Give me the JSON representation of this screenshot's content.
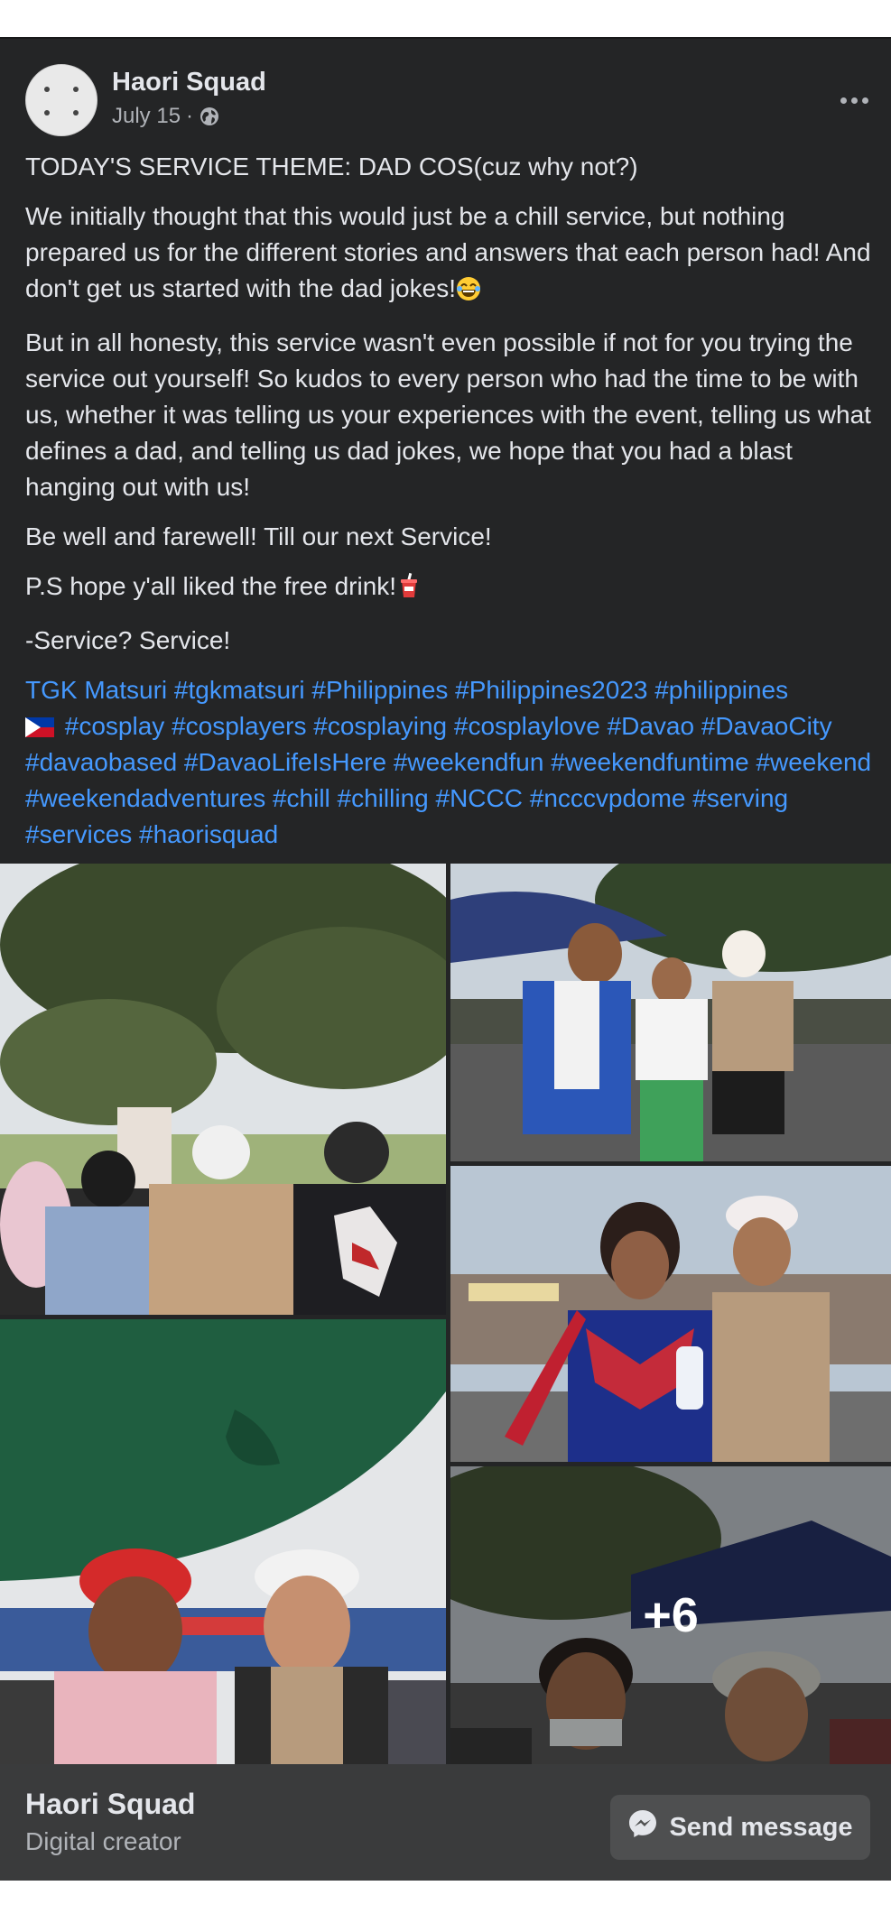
{
  "post": {
    "author": "Haori Squad",
    "date": "July 15",
    "separator": "·",
    "paragraphs": [
      "TODAY'S SERVICE THEME: DAD COS(cuz why not?)",
      "We initially thought that this would just be a chill service, but nothing prepared us for the different stories and answers that each person had! And don't get us started with the dad jokes!",
      "But in all honesty, this service wasn't even possible if not for you trying the service out yourself! So kudos to every person who had the time to be with us, whether it was telling us your experiences with the event, telling us what defines a dad, and telling us dad jokes, we hope that you had a blast hanging out with us!",
      "Be well and farewell! Till our next Service!",
      "P.S hope y'all liked the free drink!",
      "-Service? Service!"
    ],
    "hashtags_line1": "TGK Matsuri #tgkmatsuri #Philippines #Philippines2023 #philippines",
    "hashtags_rest": "#cosplay #cosplayers #cosplaying #cosplaylove #Davao #DavaoCity #davaobased #DavaoLifeIsHere #weekendfun #weekendfuntime #weekend #weekendadventures #chill #chilling #NCCC #ncccvpdome #serving #services #haorisquad",
    "more_photos": "+6"
  },
  "footer": {
    "page_name": "Haori Squad",
    "category": "Digital creator",
    "send_label": "Send message"
  },
  "icons": {
    "privacy": "globe-icon",
    "menu": "more-options-icon",
    "send": "messenger-icon",
    "flag": "philippines-flag-icon",
    "laugh": "laughing-emoji",
    "drink": "cup-with-straw-emoji"
  },
  "colors": {
    "card_bg": "#242526",
    "link": "#4599ff",
    "text": "#e4e6eb",
    "secondary_text": "#b0b3b8",
    "footer_bg": "#3a3b3c"
  }
}
